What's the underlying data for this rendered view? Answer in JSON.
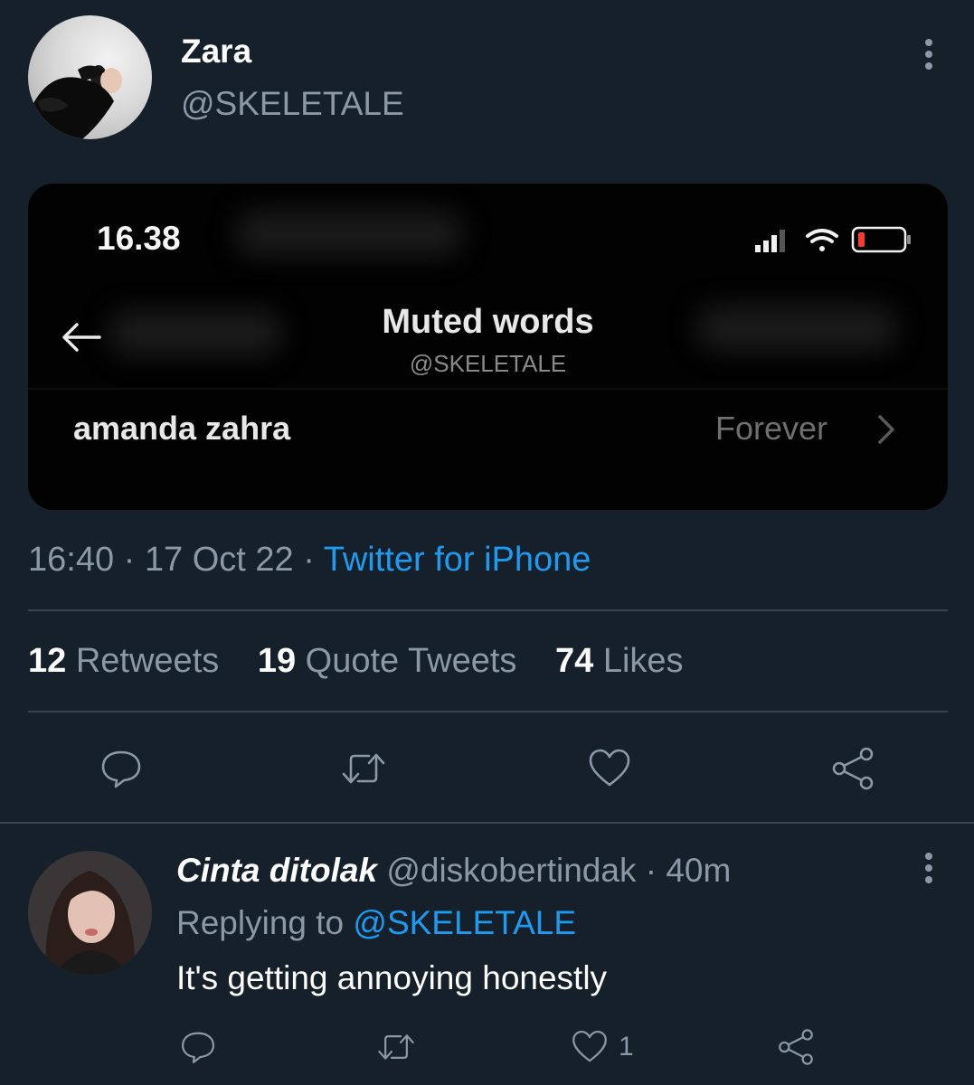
{
  "tweet": {
    "author_name": "Zara",
    "author_handle": "@SKELETALE",
    "timestamp": "16:40",
    "date": "17 Oct 22",
    "source": "Twitter for iPhone",
    "separator": "·",
    "stats": [
      {
        "count": "12",
        "label": "Retweets"
      },
      {
        "count": "19",
        "label": "Quote Tweets"
      },
      {
        "count": "74",
        "label": "Likes"
      }
    ],
    "actions": [
      {
        "name": "reply",
        "icon": "reply-icon"
      },
      {
        "name": "retweet",
        "icon": "retweet-icon"
      },
      {
        "name": "like",
        "icon": "heart-icon"
      },
      {
        "name": "share",
        "icon": "share-icon"
      }
    ]
  },
  "embedded_screenshot": {
    "status_time": "16.38",
    "title": "Muted words",
    "subtitle": "@SKELETALE",
    "muted_word": "amanda zahra",
    "duration": "Forever",
    "icons": [
      "back-arrow-icon",
      "cellular-signal-icon",
      "wifi-icon",
      "battery-icon",
      "chevron-right-icon"
    ],
    "battery_color": "#ff3b30"
  },
  "reply": {
    "author_name": "Cinta ditolak",
    "author_handle": "@diskobertindak",
    "time_ago": "40m",
    "separator": "·",
    "replying_prefix": "Replying to",
    "replying_to": "@SKELETALE",
    "text": "It's getting annoying honestly",
    "like_count": "1"
  },
  "colors": {
    "background": "#15202b",
    "card_background": "#020202",
    "accent": "#1d9bf0",
    "secondary_text": "#8b98a5",
    "divider": "#38444d"
  }
}
